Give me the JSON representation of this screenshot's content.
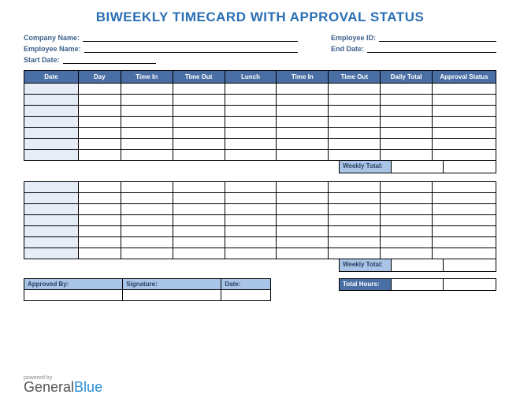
{
  "title": "BIWEEKLY TIMECARD WITH APPROVAL STATUS",
  "info": {
    "company_label": "Company Name:",
    "employee_name_label": "Employee Name:",
    "start_date_label": "Start Date:",
    "employee_id_label": "Employee ID:",
    "end_date_label": "End Date:"
  },
  "columns": {
    "date": "Date",
    "day": "Day",
    "time_in": "Time In",
    "time_out": "Time Out",
    "lunch": "Lunch",
    "time_in2": "Time In",
    "time_out2": "Time Out",
    "daily_total": "Daily Total",
    "approval_status": "Approval Status"
  },
  "weekly_total_label": "Weekly Total:",
  "total_hours_label": "Total Hours:",
  "approval": {
    "approved_by": "Approved By:",
    "signature": "Signature:",
    "date": "Date:"
  },
  "footer": {
    "powered": "powered by",
    "brand_general": "General",
    "brand_blue": "Blue"
  }
}
